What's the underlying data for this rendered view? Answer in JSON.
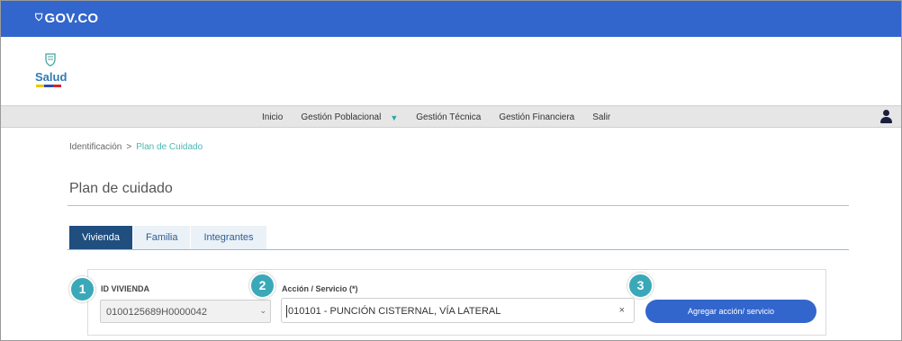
{
  "gov_bar": {
    "logo_text": "GOV.CO",
    "logo_icon": "shield-icon",
    "color": "#3366cc"
  },
  "brand": {
    "name": "Salud",
    "icon": "colombia-emblem-icon"
  },
  "nav": {
    "items": [
      {
        "label": "Inicio"
      },
      {
        "label": "Gestión Poblacional",
        "has_dropdown": true
      },
      {
        "label": "Gestión Técnica"
      },
      {
        "label": "Gestión Financiera"
      },
      {
        "label": "Salir"
      }
    ],
    "dropdown_icon": "triangle-down-icon",
    "user_icon": "user-icon"
  },
  "breadcrumb": {
    "items": [
      "Identificación",
      "Plan de Cuidado"
    ],
    "separator": ">"
  },
  "page": {
    "title": "Plan de cuidado"
  },
  "tabs": [
    {
      "label": "Vivienda",
      "active": true
    },
    {
      "label": "Familia",
      "active": false
    },
    {
      "label": "Integrantes",
      "active": false
    }
  ],
  "form": {
    "vivienda": {
      "label": "ID VIVIENDA",
      "value": "0100125689H0000042"
    },
    "accion": {
      "label": "Acción / Servicio (*)",
      "value": "010101 - PUNCIÓN CISTERNAL, VÍA LATERAL",
      "clear_symbol": "×"
    },
    "add_button": {
      "label": "Agregar acción/ servicio"
    }
  },
  "markers": [
    "1",
    "2",
    "3"
  ],
  "colors": {
    "accent": "#3366cc",
    "teal": "#3aa8b8",
    "tab_active": "#1f4e7f"
  }
}
